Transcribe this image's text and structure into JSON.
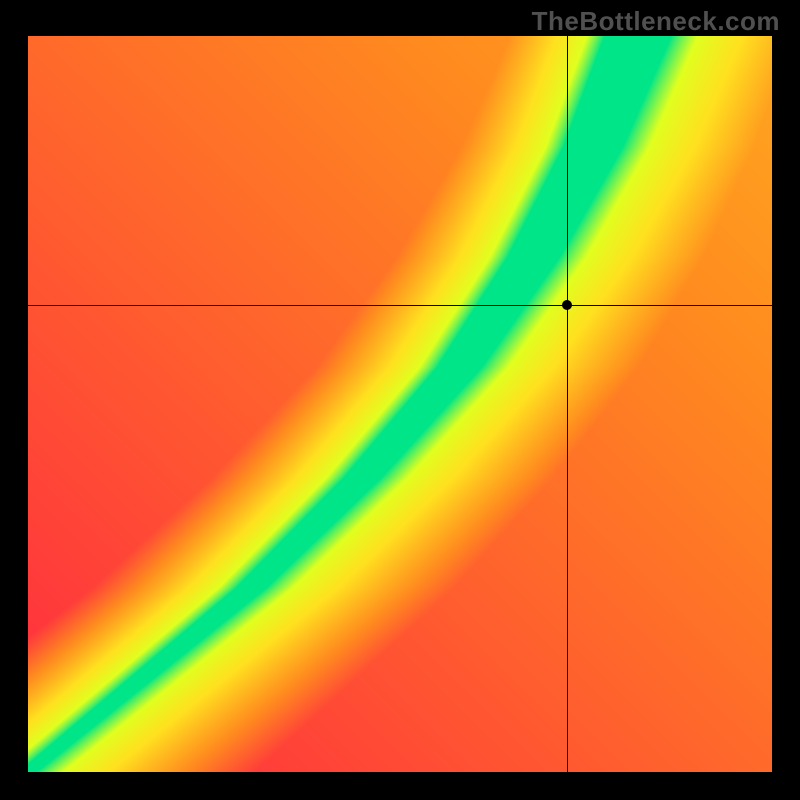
{
  "watermark": "TheBottleneck.com",
  "chart_data": {
    "type": "heatmap",
    "title": "",
    "xlabel": "",
    "ylabel": "",
    "xlim": [
      0,
      1
    ],
    "ylim": [
      0,
      1
    ],
    "colormap": {
      "low": "#ff1f44",
      "mid_low": "#ff8a1f",
      "mid": "#ffe01f",
      "mid_high": "#e0ff1f",
      "high": "#00e588"
    },
    "crosshair": {
      "x": 0.725,
      "y": 0.635
    },
    "dot": {
      "x": 0.725,
      "y": 0.635
    },
    "curve_anchors": [
      {
        "t": 0.0,
        "x": 0.0
      },
      {
        "t": 0.25,
        "x": 0.3
      },
      {
        "t": 0.4,
        "x": 0.45
      },
      {
        "t": 0.55,
        "x": 0.58
      },
      {
        "t": 0.7,
        "x": 0.68
      },
      {
        "t": 0.85,
        "x": 0.76
      },
      {
        "t": 1.0,
        "x": 0.82
      }
    ],
    "band_half_width_top": 0.045,
    "band_half_width_bottom": 0.012
  }
}
